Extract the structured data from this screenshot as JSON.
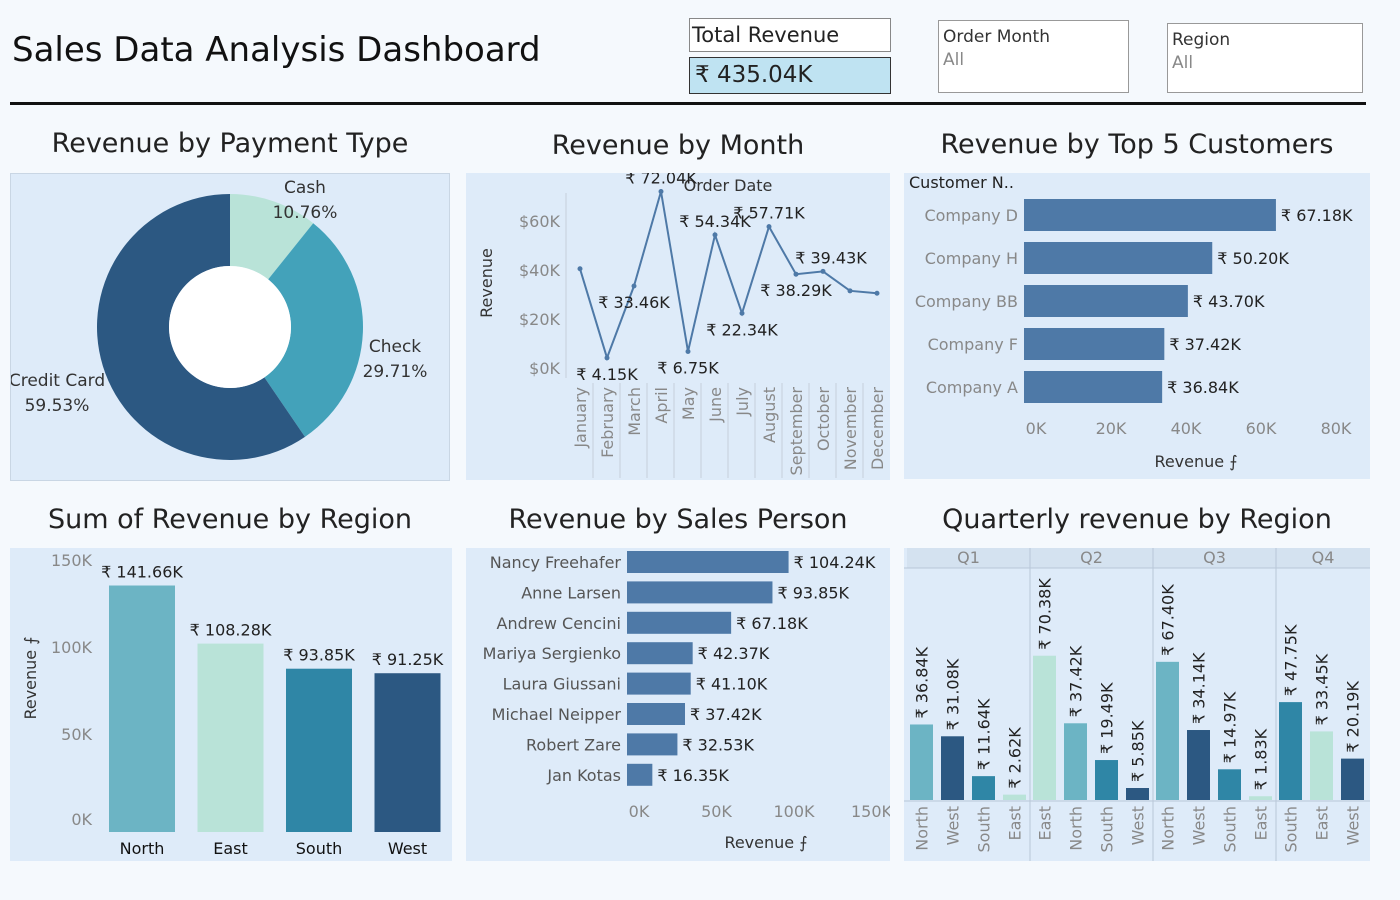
{
  "header": {
    "title": "Sales Data Analysis Dashboard",
    "kpi_label": "Total Revenue",
    "kpi_value": "₹ 435.04K",
    "filters": [
      {
        "label": "Order Month",
        "value": "All"
      },
      {
        "label": "Region",
        "value": "All"
      }
    ]
  },
  "panels": {
    "payment": "Revenue by Payment Type",
    "month": "Revenue by Month",
    "customers": "Revenue by Top 5 Customers",
    "region": "Sum of Revenue by Region",
    "salesperson": "Revenue by Sales Person",
    "quarterly": "Quarterly revenue by Region"
  },
  "colors": {
    "panel_bg": "#deebf9",
    "bar_blue": "#4e79a7",
    "line": "#4e79a7",
    "north": "#6cb4c4",
    "east": "#b9e3d8",
    "south": "#2f86a6",
    "west": "#2c5882",
    "cash": "#b9e3d8",
    "check": "#43a2ba",
    "credit": "#2c5882"
  },
  "chart_data": [
    {
      "type": "pie",
      "title": "Revenue by Payment Type",
      "slices": [
        {
          "label": "Cash",
          "value": 10.76,
          "display": "10.76%"
        },
        {
          "label": "Check",
          "value": 29.71,
          "display": "29.71%"
        },
        {
          "label": "Credit Card",
          "value": 59.53,
          "display": "59.53%"
        }
      ]
    },
    {
      "type": "line",
      "title": "Revenue by Month",
      "xlabel": "Order Date",
      "ylabel": "Revenue",
      "categories": [
        "January",
        "February",
        "March",
        "April",
        "May",
        "June",
        "July",
        "August",
        "September",
        "October",
        "November",
        "December"
      ],
      "values": [
        40.5,
        4.15,
        33.46,
        72.04,
        6.75,
        54.34,
        22.34,
        57.71,
        38.29,
        39.43,
        31.5,
        30.5
      ],
      "data_labels": [
        "",
        "₹ 4.15K",
        "₹ 33.46K",
        "₹ 72.04K",
        "₹ 6.75K",
        "₹ 54.34K",
        "₹ 22.34K",
        "₹ 57.71K",
        "₹ 38.29K",
        "₹ 39.43K",
        "",
        ""
      ],
      "yticks": [
        "$0K",
        "$20K",
        "$40K",
        "$60K"
      ],
      "ylim": [
        0,
        75
      ]
    },
    {
      "type": "bar",
      "title": "Revenue by Top 5 Customers",
      "header": "Customer N..",
      "xlabel": "Revenue",
      "categories": [
        "Company D",
        "Company H",
        "Company BB",
        "Company F",
        "Company A"
      ],
      "values": [
        67.18,
        50.2,
        43.7,
        37.42,
        36.84
      ],
      "data_labels": [
        "₹ 67.18K",
        "₹ 50.20K",
        "₹ 43.70K",
        "₹ 37.42K",
        "₹ 36.84K"
      ],
      "xticks": [
        "0K",
        "20K",
        "40K",
        "60K",
        "80K"
      ],
      "xlim": [
        0,
        80
      ]
    },
    {
      "type": "bar",
      "title": "Sum of Revenue by Region",
      "ylabel": "Revenue",
      "categories": [
        "North",
        "East",
        "South",
        "West"
      ],
      "values": [
        141.66,
        108.28,
        93.85,
        91.25
      ],
      "data_labels": [
        "₹ 141.66K",
        "₹ 108.28K",
        "₹ 93.85K",
        "₹ 91.25K"
      ],
      "yticks": [
        "0K",
        "50K",
        "100K",
        "150K"
      ],
      "ylim": [
        0,
        150
      ]
    },
    {
      "type": "bar",
      "title": "Revenue by Sales Person",
      "xlabel": "Revenue",
      "categories": [
        "Nancy Freehafer",
        "Anne Larsen",
        "Andrew Cencini",
        "Mariya Sergienko",
        "Laura Giussani",
        "Michael Neipper",
        "Robert Zare",
        "Jan Kotas"
      ],
      "values": [
        104.24,
        93.85,
        67.18,
        42.37,
        41.1,
        37.42,
        32.53,
        16.35
      ],
      "data_labels": [
        "₹ 104.24K",
        "₹ 93.85K",
        "₹ 67.18K",
        "₹ 42.37K",
        "₹ 41.10K",
        "₹ 37.42K",
        "₹ 32.53K",
        "₹ 16.35K"
      ],
      "xticks": [
        "0K",
        "50K",
        "100K",
        "150K"
      ],
      "xlim": [
        0,
        150
      ]
    },
    {
      "type": "bar",
      "title": "Quarterly revenue by Region",
      "ymax": 75,
      "quarters": [
        {
          "name": "Q1",
          "bars": [
            {
              "region": "North",
              "value": 36.84,
              "label": "₹ 36.84K"
            },
            {
              "region": "West",
              "value": 31.08,
              "label": "₹ 31.08K"
            },
            {
              "region": "South",
              "value": 11.64,
              "label": "₹ 11.64K"
            },
            {
              "region": "East",
              "value": 2.62,
              "label": "₹ 2.62K"
            }
          ]
        },
        {
          "name": "Q2",
          "bars": [
            {
              "region": "East",
              "value": 70.38,
              "label": "₹ 70.38K"
            },
            {
              "region": "North",
              "value": 37.42,
              "label": "₹ 37.42K"
            },
            {
              "region": "South",
              "value": 19.49,
              "label": "₹ 19.49K"
            },
            {
              "region": "West",
              "value": 5.85,
              "label": "₹ 5.85K"
            }
          ]
        },
        {
          "name": "Q3",
          "bars": [
            {
              "region": "North",
              "value": 67.4,
              "label": "₹ 67.40K"
            },
            {
              "region": "West",
              "value": 34.14,
              "label": "₹ 34.14K"
            },
            {
              "region": "South",
              "value": 14.97,
              "label": "₹ 14.97K"
            },
            {
              "region": "East",
              "value": 1.83,
              "label": "₹ 1.83K"
            }
          ]
        },
        {
          "name": "Q4",
          "bars": [
            {
              "region": "South",
              "value": 47.75,
              "label": "₹ 47.75K"
            },
            {
              "region": "East",
              "value": 33.45,
              "label": "₹ 33.45K"
            },
            {
              "region": "West",
              "value": 20.19,
              "label": "₹ 20.19K"
            }
          ]
        }
      ]
    }
  ]
}
